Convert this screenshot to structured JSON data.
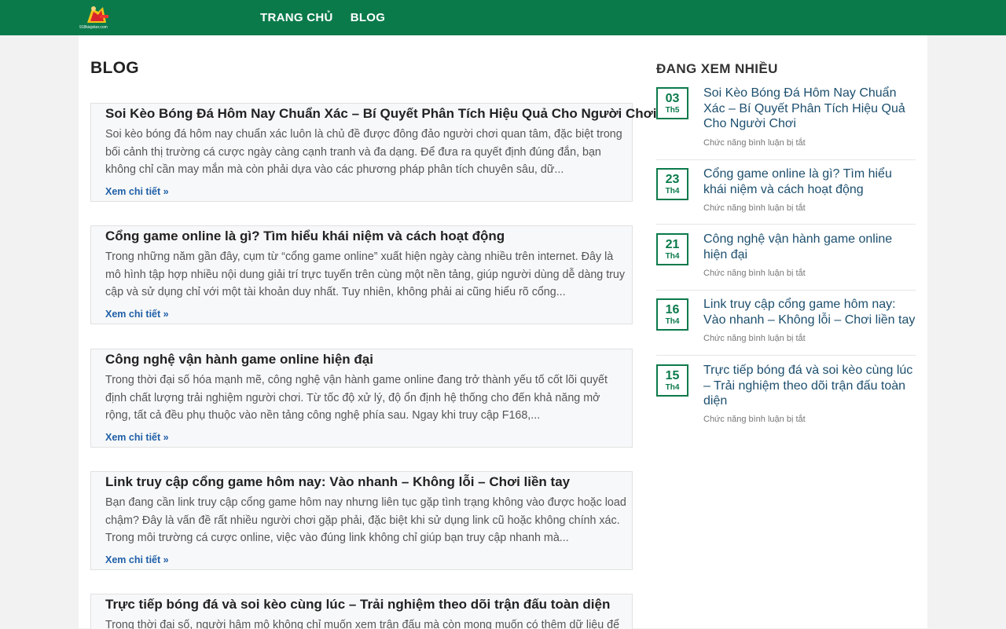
{
  "header": {
    "logo_text": "918kisjoker.com",
    "nav": [
      "TRANG CHỦ",
      "BLOG"
    ],
    "brand_color": "#0b7a4b"
  },
  "main": {
    "title": "BLOG",
    "read_more_label": "Xem chi tiết »",
    "posts": [
      {
        "title": "Soi Kèo Bóng Đá Hôm Nay Chuẩn Xác – Bí Quyết Phân Tích Hiệu Quả Cho Người Chơi",
        "excerpt": "Soi kèo bóng đá hôm nay chuẩn xác luôn là chủ đề được đông đảo người chơi quan tâm, đặc biệt trong bối cảnh thị trường cá cược ngày càng cạnh tranh và đa dạng. Để đưa ra quyết định đúng đắn, bạn không chỉ cần may mắn mà còn phải dựa vào các phương pháp phân tích chuyên sâu, dữ..."
      },
      {
        "title": "Cổng game online là gì? Tìm hiểu khái niệm và cách hoạt động",
        "excerpt": "Trong những năm gần đây, cụm từ “cổng game online” xuất hiện ngày càng nhiều trên internet. Đây là mô hình tập hợp nhiều nội dung giải trí trực tuyến trên cùng một nền tảng, giúp người dùng dễ dàng truy cập và sử dụng chỉ với một tài khoản duy nhất. Tuy nhiên, không phải ai cũng hiểu rõ cổng..."
      },
      {
        "title": "Công nghệ vận hành game online hiện đại",
        "excerpt": "Trong thời đại số hóa mạnh mẽ, công nghệ vận hành game online đang trở thành yếu tố cốt lõi quyết định chất lượng trải nghiệm người chơi. Từ tốc độ xử lý, độ ổn định hệ thống cho đến khả năng mở rộng, tất cả đều phụ thuộc vào nền tảng công nghệ phía sau. Ngay khi truy cập F168,..."
      },
      {
        "title": "Link truy cập cổng game hôm nay: Vào nhanh – Không lỗi – Chơi liền tay",
        "excerpt": "Bạn đang cần link truy cập cổng game hôm nay nhưng liên tục gặp tình trạng không vào được hoặc load chậm? Đây là vấn đề rất nhiều người chơi gặp phải, đặc biệt khi sử dụng link cũ hoặc không chính xác. Trong môi trường cá cược online, việc vào đúng link không chỉ giúp bạn truy cập nhanh mà..."
      },
      {
        "title": "Trực tiếp bóng đá và soi kèo cùng lúc – Trải nghiệm theo dõi trận đấu toàn diện",
        "excerpt": "Trong thời đại số, người hâm mộ không chỉ muốn xem trận đấu mà còn mong muốn có thêm dữ liệu để"
      }
    ]
  },
  "sidebar": {
    "title": "ĐANG XEM NHIỀU",
    "meta_label": "Chức năng bình luận bị tắt",
    "items": [
      {
        "day": "03",
        "month": "Th5",
        "title": "Soi Kèo Bóng Đá Hôm Nay Chuẩn Xác – Bí Quyết Phân Tích Hiệu Quả Cho Người Chơi"
      },
      {
        "day": "23",
        "month": "Th4",
        "title": "Cổng game online là gì? Tìm hiểu khái niệm và cách hoạt động"
      },
      {
        "day": "21",
        "month": "Th4",
        "title": "Công nghệ vận hành game online hiện đại"
      },
      {
        "day": "16",
        "month": "Th4",
        "title": "Link truy cập cổng game hôm nay: Vào nhanh – Không lỗi – Chơi liền tay"
      },
      {
        "day": "15",
        "month": "Th4",
        "title": "Trực tiếp bóng đá và soi kèo cùng lúc – Trải nghiệm theo dõi trận đấu toàn diện"
      }
    ]
  }
}
